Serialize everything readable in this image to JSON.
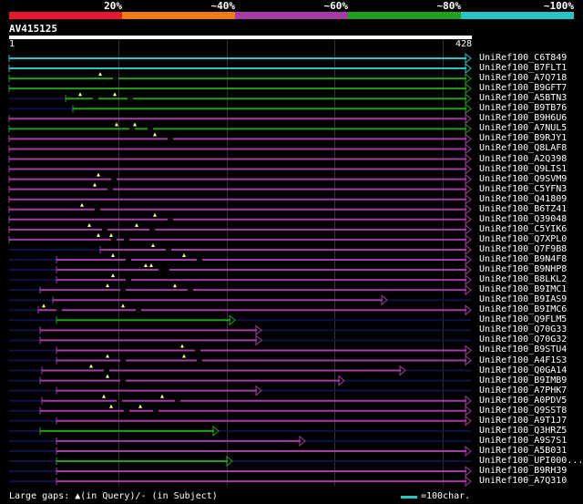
{
  "legend": {
    "labels": [
      "20%",
      "~40%",
      "~60%",
      "~80%",
      "~100%"
    ],
    "colors": [
      "#e8172d",
      "#ee7b16",
      "#a53ca5",
      "#22a01c",
      "#27c4c4"
    ]
  },
  "query": {
    "name": "AV415125",
    "start": "1",
    "end": "428"
  },
  "footer": {
    "gaps_text": "Large gaps: ▲(in Query)/- (in Subject)",
    "scale_text": "=100char."
  },
  "hits": [
    {
      "name": "UniRef100_C6T849",
      "color": "#27c4c4"
    },
    {
      "name": "UniRef100_B7FLT1",
      "color": "#27c4c4"
    },
    {
      "name": "UniRef100_A7Q718",
      "color": "#22a01c"
    },
    {
      "name": "UniRef100_B9GFT7",
      "color": "#22a01c"
    },
    {
      "name": "UniRef100_A5BTN3",
      "color": "#22a01c"
    },
    {
      "name": "UniRef100_B9TB76",
      "color": "#22a01c"
    },
    {
      "name": "UniRef100_B9H6U6",
      "color": "#a53ca5"
    },
    {
      "name": "UniRef100_A7NUL5",
      "color": "#22a01c"
    },
    {
      "name": "UniRef100_B9RJY1",
      "color": "#a53ca5"
    },
    {
      "name": "UniRef100_Q8LAF8",
      "color": "#a53ca5"
    },
    {
      "name": "UniRef100_A2Q398",
      "color": "#a53ca5"
    },
    {
      "name": "UniRef100_Q9LIS1",
      "color": "#a53ca5"
    },
    {
      "name": "UniRef100_Q9SVM9",
      "color": "#a53ca5"
    },
    {
      "name": "UniRef100_C5YFN3",
      "color": "#a53ca5"
    },
    {
      "name": "UniRef100_Q41809",
      "color": "#a53ca5"
    },
    {
      "name": "UniRef100_B6TZ41",
      "color": "#a53ca5"
    },
    {
      "name": "UniRef100_Q39048",
      "color": "#a53ca5"
    },
    {
      "name": "UniRef100_C5YIK6",
      "color": "#a53ca5"
    },
    {
      "name": "UniRef100_Q7XPL0",
      "color": "#a53ca5"
    },
    {
      "name": "UniRef100_Q7F9B8",
      "color": "#a53ca5"
    },
    {
      "name": "UniRef100_B9N4F8",
      "color": "#a53ca5"
    },
    {
      "name": "UniRef100_B9NHP8",
      "color": "#a53ca5"
    },
    {
      "name": "UniRef100_B8LKL2",
      "color": "#a53ca5"
    },
    {
      "name": "UniRef100_B9IMC1",
      "color": "#a53ca5"
    },
    {
      "name": "UniRef100_B9IAS9",
      "color": "#a53ca5"
    },
    {
      "name": "UniRef100_B9IMC6",
      "color": "#a53ca5"
    },
    {
      "name": "UniRef100_Q9FLM5",
      "color": "#22a01c"
    },
    {
      "name": "UniRef100_Q70G33",
      "color": "#a53ca5"
    },
    {
      "name": "UniRef100_Q70G32",
      "color": "#a53ca5"
    },
    {
      "name": "UniRef100_B9STU4",
      "color": "#a53ca5"
    },
    {
      "name": "UniRef100_A4F1S3",
      "color": "#a53ca5"
    },
    {
      "name": "UniRef100_Q0GA14",
      "color": "#a53ca5"
    },
    {
      "name": "UniRef100_B9IMB9",
      "color": "#a53ca5"
    },
    {
      "name": "UniRef100_A7PHK7",
      "color": "#a53ca5"
    },
    {
      "name": "UniRef100_A0PDV5",
      "color": "#a53ca5"
    },
    {
      "name": "UniRef100_Q9SST8",
      "color": "#a53ca5"
    },
    {
      "name": "UniRef100_A9T1J7",
      "color": "#a53ca5"
    },
    {
      "name": "UniRef100_Q3HRZ5",
      "color": "#22a01c"
    },
    {
      "name": "UniRef100_A9S7S1",
      "color": "#a53ca5"
    },
    {
      "name": "UniRef100_A5B031",
      "color": "#a53ca5"
    },
    {
      "name": "UniRef100_UPI000...",
      "color": "#22a01c"
    },
    {
      "name": "UniRef100_B9RH39",
      "color": "#a53ca5"
    },
    {
      "name": "UniRef100_A7Q310",
      "color": "#a53ca5"
    }
  ]
}
